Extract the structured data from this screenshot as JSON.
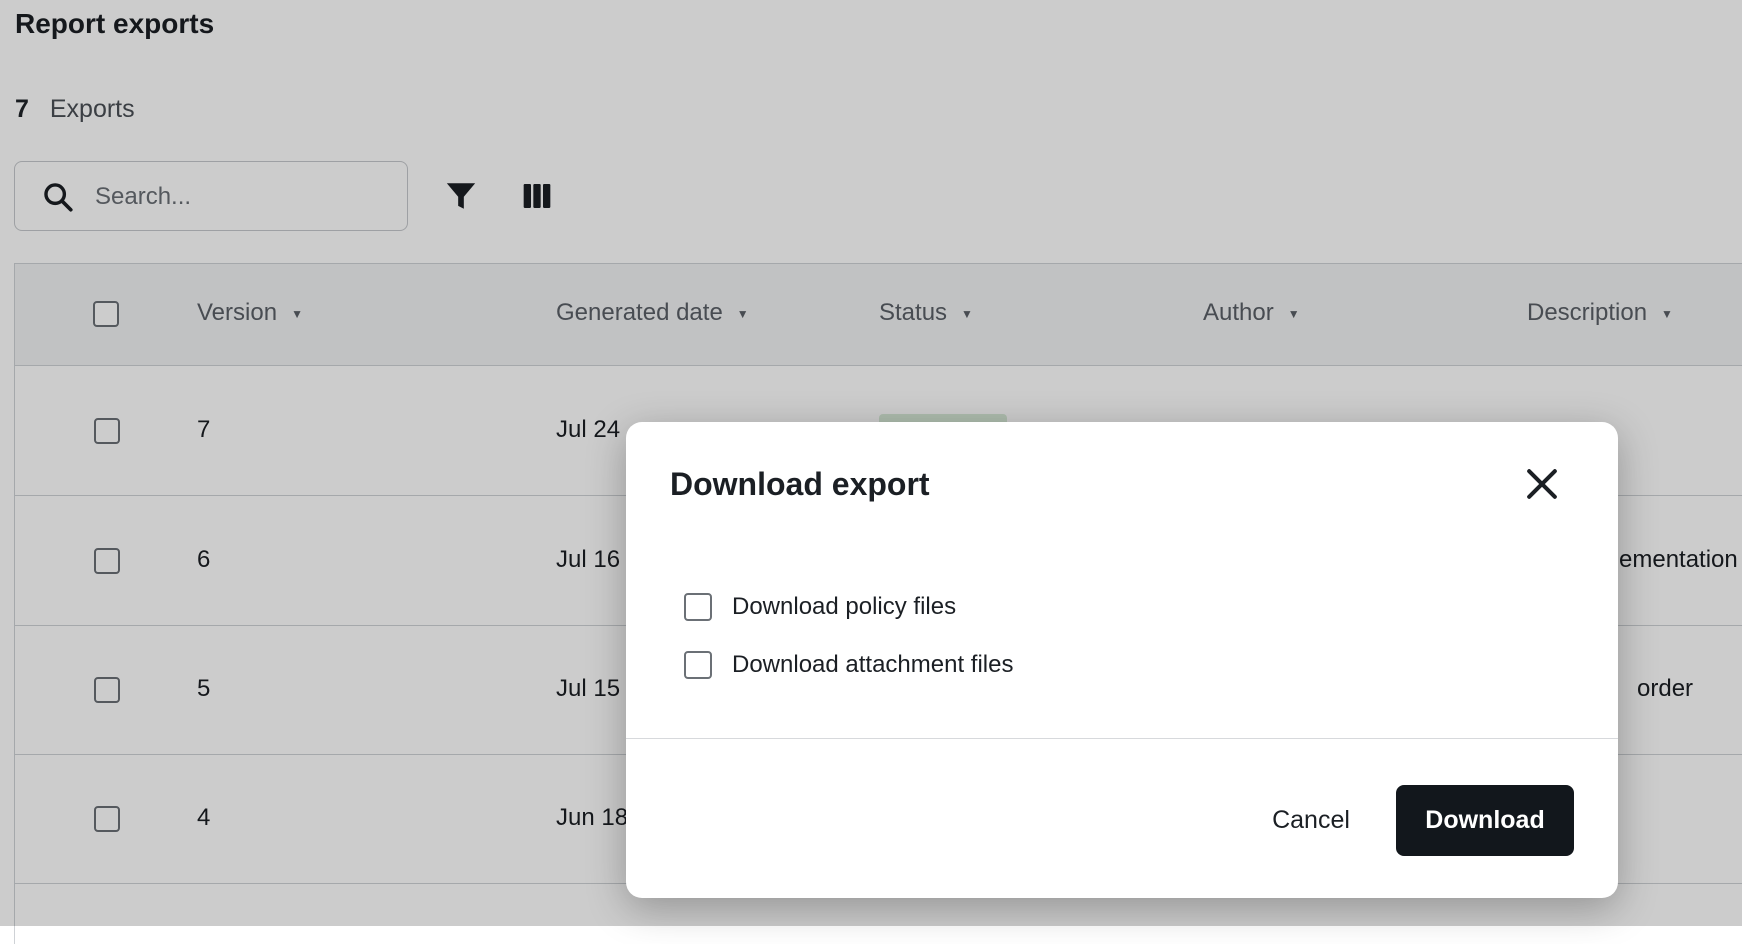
{
  "page": {
    "title": "Report exports",
    "count": "7",
    "count_label": "Exports",
    "search": {
      "placeholder": "Search...",
      "icon": "search-icon"
    },
    "toolbar": {
      "filter_icon": "filter-icon",
      "columns_icon": "columns-icon"
    }
  },
  "table": {
    "columns": [
      "Version",
      "Generated date",
      "Status",
      "Author",
      "Description"
    ],
    "rows": [
      {
        "version": "7",
        "date": "Jul 24",
        "status": "",
        "author": "",
        "description": ""
      },
      {
        "version": "6",
        "date": "Jul 16",
        "status": "",
        "author": "",
        "description": "ementation"
      },
      {
        "version": "5",
        "date": "Jul 15",
        "status": "",
        "author": "",
        "description": "order"
      },
      {
        "version": "4",
        "date": "Jun 18",
        "status": "",
        "author": "",
        "description": ""
      }
    ]
  },
  "dialog": {
    "title": "Download export",
    "close_icon": "close-icon",
    "options": [
      "Download policy files",
      "Download attachment files"
    ],
    "cancel_label": "Cancel",
    "download_label": "Download"
  },
  "colors": {
    "primary_button": "#12171c",
    "status_chip_bg": "#d9ecd9",
    "overlay": "rgba(0,0,0,0.20)"
  }
}
